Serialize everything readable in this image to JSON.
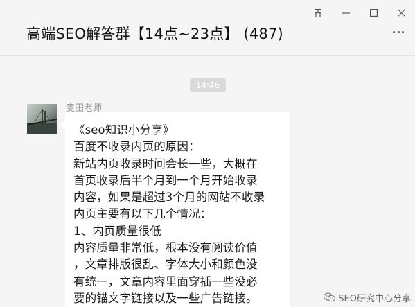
{
  "window": {
    "controls": {
      "pin_label": "ᅮ",
      "minimize": "minimize-icon",
      "maximize": "maximize-icon",
      "close": "close-icon"
    }
  },
  "chat": {
    "title": "高端SEO解答群【14点~23点】 (487)",
    "more": "more-icon",
    "timestamp": "14:46"
  },
  "message": {
    "sender": "麦田老师",
    "lines": [
      "《seo知识小分享》",
      "百度不收录内页的原因：",
      "新站内页收录时间会长一些，大概在",
      "首页收录后半个月到一个月开始收录",
      "内容，如果是超过3个月的网站不收录",
      "内页主要有以下几个情况：",
      "1、内页质量很低",
      "内容质量非常低，根本没有阅读价值",
      "，文章排版很乱、字体大小和颜色没",
      "有统一，文章内容里面穿插一些没必",
      "要的锚文字链接以及一些广告链接。"
    ]
  },
  "watermark": {
    "text": "SEO研究中心分享",
    "icon": "wechat-icon"
  }
}
